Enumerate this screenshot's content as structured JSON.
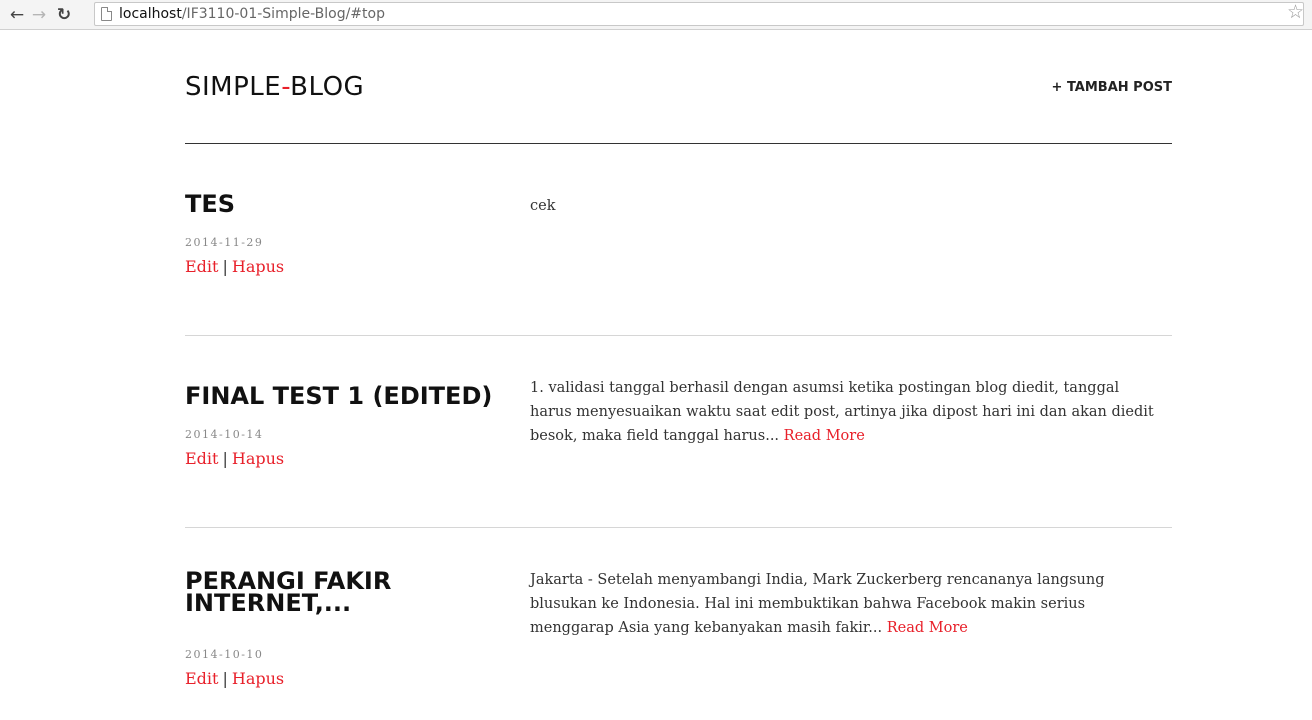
{
  "browser": {
    "url_host": "localhost",
    "url_path": "/IF3110-01-Simple-Blog/#top",
    "back_icon": "arrow-left-icon",
    "forward_icon": "arrow-right-icon",
    "reload_icon": "reload-icon",
    "star_icon": "star-icon"
  },
  "header": {
    "logo_part1": "SIMPLE",
    "logo_dash": "-",
    "logo_part2": "BLOG",
    "add_post_label": "+ TAMBAH POST"
  },
  "colors": {
    "accent": "#e8202a",
    "text": "#333333",
    "divider": "#d6d6d6"
  },
  "posts": [
    {
      "title": "TES",
      "date": "2014-11-29",
      "edit_label": "Edit",
      "separator": "|",
      "delete_label": "Hapus",
      "body": "cek",
      "read_more": ""
    },
    {
      "title": "FINAL TEST 1 (EDITED)",
      "date": "2014-10-14",
      "edit_label": "Edit",
      "separator": "|",
      "delete_label": "Hapus",
      "body": "1. validasi tanggal berhasil dengan asumsi ketika postingan blog diedit, tanggal harus menyesuaikan waktu saat edit post, artinya jika dipost hari ini dan akan diedit besok, maka field tanggal harus...",
      "read_more": "Read More"
    },
    {
      "title": "PERANGI FAKIR INTERNET,...",
      "date": "2014-10-10",
      "edit_label": "Edit",
      "separator": "|",
      "delete_label": "Hapus",
      "body": "Jakarta - Setelah menyambangi India, Mark Zuckerberg rencananya langsung blusukan ke Indonesia. Hal ini membuktikan bahwa Facebook makin serius menggarap Asia yang kebanyakan masih fakir...",
      "read_more": "Read More"
    }
  ]
}
